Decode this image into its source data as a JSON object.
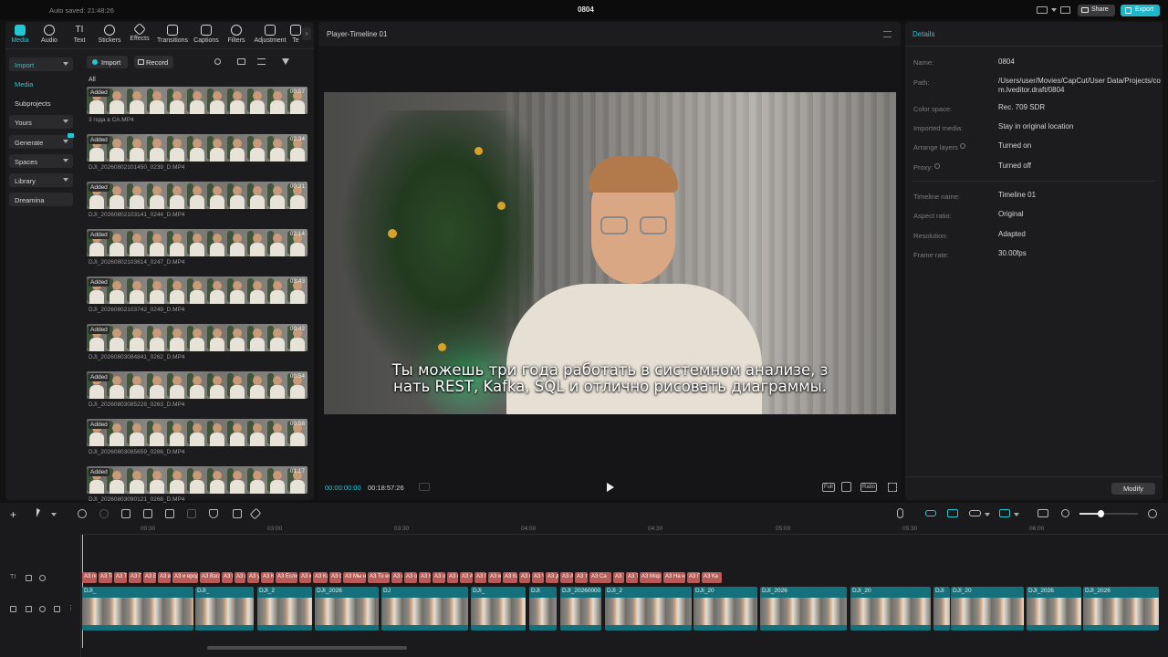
{
  "titlebar": {
    "autosave": "Auto saved: 21:48:26",
    "project": "0804",
    "share_label": "Share",
    "export_label": "Export"
  },
  "media_tabs": [
    {
      "label": "Media",
      "icon": "media-icon",
      "active": true
    },
    {
      "label": "Audio",
      "icon": "audio-icon"
    },
    {
      "label": "Text",
      "icon": "text-icon"
    },
    {
      "label": "Stickers",
      "icon": "stickers-icon"
    },
    {
      "label": "Effects",
      "icon": "effects-icon"
    },
    {
      "label": "Transitions",
      "icon": "transitions-icon"
    },
    {
      "label": "Captions",
      "icon": "captions-icon"
    },
    {
      "label": "Filters",
      "icon": "filters-icon"
    },
    {
      "label": "Adjustment",
      "icon": "adjustment-icon"
    },
    {
      "label": "Te",
      "icon": "templates-icon"
    }
  ],
  "sidebar": {
    "items": [
      {
        "label": "Import",
        "active": true,
        "dropdown": true
      },
      {
        "label": "Media",
        "active": true
      },
      {
        "label": "Subprojects"
      },
      {
        "label": "Yours",
        "dropdown": true
      },
      {
        "label": "Generate",
        "dropdown": true
      },
      {
        "label": "Spaces",
        "dropdown": true
      },
      {
        "label": "Library",
        "dropdown": true
      },
      {
        "label": "Dreamina"
      }
    ]
  },
  "media_toolbar": {
    "import_label": "Import",
    "record_label": "Record",
    "filter_all": "All"
  },
  "media_items": [
    {
      "tag": "Added",
      "duration": "00:57",
      "name": "3 года в СА.MP4"
    },
    {
      "tag": "Added",
      "duration": "02:34",
      "name": "DJI_20260802101450_0239_D.MP4"
    },
    {
      "tag": "Added",
      "duration": "00:31",
      "name": "DJI_20260802103141_0244_D.MP4"
    },
    {
      "tag": "Added",
      "duration": "02:14",
      "name": "DJI_20260802103614_0247_D.MP4"
    },
    {
      "tag": "Added",
      "duration": "03:43",
      "name": "DJI_20260802103742_0249_D.MP4"
    },
    {
      "tag": "Added",
      "duration": "00:42",
      "name": "DJI_20260803084841_0262_D.MP4"
    },
    {
      "tag": "Added",
      "duration": "00:54",
      "name": "DJI_20260803085228_0263_D.MP4"
    },
    {
      "tag": "Added",
      "duration": "00:58",
      "name": "DJI_20260803085659_0266_D.MP4"
    },
    {
      "tag": "Added",
      "duration": "01:17",
      "name": "DJI_20260803090121_0268_D.MP4"
    }
  ],
  "player": {
    "title": "Player-Timeline 01",
    "subtitle_line1": "Ты можешь три года работать в системном анализе, з",
    "subtitle_line2": "нать REST, Kafka, SQL и отлично рисовать диаграммы.",
    "current_time": "00:00:00:00",
    "total_time": "00:18:57:26",
    "full_label": "Full",
    "ratio_label": "Ratio"
  },
  "details": {
    "header": "Details",
    "rows": [
      {
        "label": "Name:",
        "value": "0804"
      },
      {
        "label": "Path:",
        "value": "/Users/user/Movies/CapCut/User Data/Projects/com.lveditor.draft/0804"
      },
      {
        "label": "Color space:",
        "value": "Rec. 709 SDR"
      },
      {
        "label": "Imported media:",
        "value": "Stay in original location"
      },
      {
        "label": "Arrange layers",
        "value": "Turned on"
      },
      {
        "label": "Proxy:",
        "value": "Turned off"
      },
      {
        "label": "Timeline name:",
        "value": "Timeline 01"
      },
      {
        "label": "Aspect ratio:",
        "value": "Original"
      },
      {
        "label": "Resolution:",
        "value": "Adapted"
      },
      {
        "label": "Frame rate:",
        "value": "30.00fps"
      }
    ],
    "modify_label": "Modify"
  },
  "timeline": {
    "ruler": [
      "00:30",
      "03:00",
      "03:30",
      "04:00",
      "04:30",
      "05:00",
      "05:30",
      "06:00"
    ],
    "text_clip_label": "A3",
    "text_clips": [
      "A3 по",
      "A3 Тол",
      "A3 Те",
      "A3 Пе",
      "A3 Е",
      "A3 в",
      "A3 и вроде",
      "A3 Взгл",
      "A3 В",
      "A3 и",
      "A3 у",
      "A3 К",
      "A3 Если",
      "A3 кр",
      "A3 Ка",
      "A3 От",
      "A3 Мы не",
      "A3 То ест",
      "A3 в",
      "A3 о",
      "A3 Н",
      "A3 о",
      "A3 к",
      "A3 А",
      "A3 П",
      "A3 м",
      "A3 Ка",
      "A3 и",
      "A3 Ч",
      "A3 д",
      "A3 А",
      "A3 т",
      "A3 Са",
      "A3 Т",
      "A3 Ты",
      "A3 Мор",
      "A3 На н",
      "A3 Пе",
      "A3 Ка"
    ],
    "video_clips": [
      "DJI_",
      "DJI_",
      "DJI_2",
      "DJI_2026",
      "DJ",
      "DJI_",
      "DJI",
      "DJI_20260000",
      "DJI_2",
      "DJI_20",
      "DJI_2026",
      "DJI_20",
      "DJI",
      "DJI_20",
      "DJI_2026",
      "DJI_2026"
    ]
  }
}
